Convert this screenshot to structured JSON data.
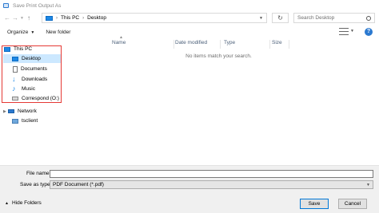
{
  "window": {
    "title": "Save Print Output As"
  },
  "address": {
    "crumbs": [
      "This PC",
      "Desktop"
    ],
    "separator": "›"
  },
  "search": {
    "placeholder": "Search Desktop"
  },
  "toolbar": {
    "organize_label": "Organize",
    "new_folder_label": "New folder",
    "help_label": "?"
  },
  "nav_pane": {
    "items": [
      {
        "label": "This PC"
      },
      {
        "label": "Desktop"
      },
      {
        "label": "Documents"
      },
      {
        "label": "Downloads"
      },
      {
        "label": "Music"
      },
      {
        "label": "Correspond (O:)"
      },
      {
        "label": "Network"
      },
      {
        "label": "tsclient"
      }
    ]
  },
  "columns": [
    {
      "label": "Name"
    },
    {
      "label": "Date modified"
    },
    {
      "label": "Type"
    },
    {
      "label": "Size"
    }
  ],
  "content": {
    "empty_message": "No items match your search."
  },
  "footer": {
    "file_name_label": "File name:",
    "file_name_value": "",
    "save_as_type_label": "Save as type:",
    "save_as_type_value": "PDF Document (*.pdf)",
    "hide_folders_label": "Hide Folders",
    "save_label": "Save",
    "cancel_label": "Cancel"
  },
  "colors": {
    "accent": "#1e88e5",
    "highlight_border": "#e53935",
    "selection": "#cce8ff"
  }
}
